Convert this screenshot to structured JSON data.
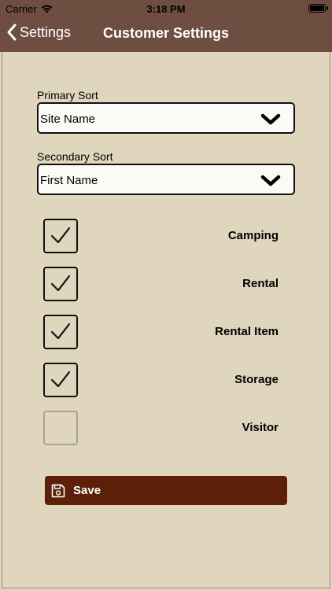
{
  "status_bar": {
    "carrier": "Carrier",
    "time": "3:18 PM",
    "wifi_icon": "wifi-icon",
    "battery_icon": "battery-icon"
  },
  "nav": {
    "back_label": "Settings",
    "back_icon": "chevron-left-icon",
    "title": "Customer Settings"
  },
  "colors": {
    "header_bg": "#6e4e40",
    "page_bg": "#e0d6bd",
    "save_button_bg": "#5c2009",
    "select_bg": "#fcfaf6"
  },
  "form": {
    "primary_sort": {
      "label": "Primary Sort",
      "value": "Site Name",
      "icon": "chevron-down-icon"
    },
    "secondary_sort": {
      "label": "Secondary Sort",
      "value": "First Name",
      "icon": "chevron-down-icon"
    },
    "options": [
      {
        "label": "Camping",
        "checked": true
      },
      {
        "label": "Rental",
        "checked": true
      },
      {
        "label": "Rental Item",
        "checked": true
      },
      {
        "label": "Storage",
        "checked": true
      },
      {
        "label": "Visitor",
        "checked": false
      }
    ]
  },
  "save_button": {
    "label": "Save",
    "icon": "floppy-disk-icon"
  }
}
